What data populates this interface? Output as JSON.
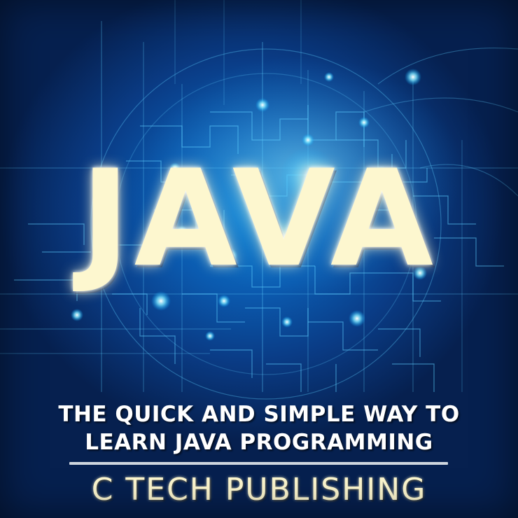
{
  "cover": {
    "title": "JAVA",
    "subtitle_line1": "THE QUICK AND SIMPLE WAY TO",
    "subtitle_line2": "LEARN JAVA PROGRAMMING",
    "publisher": "C TECH PUBLISHING"
  },
  "colors": {
    "background_center": "#0f7fd0",
    "background_edge": "#06204f",
    "circuit_lines": "#5fd0ff",
    "title_text": "#fdf7cf",
    "subtitle_text": "#ffffff",
    "divider": "#cfd6de"
  },
  "icons": [
    "circuit-board-background"
  ]
}
